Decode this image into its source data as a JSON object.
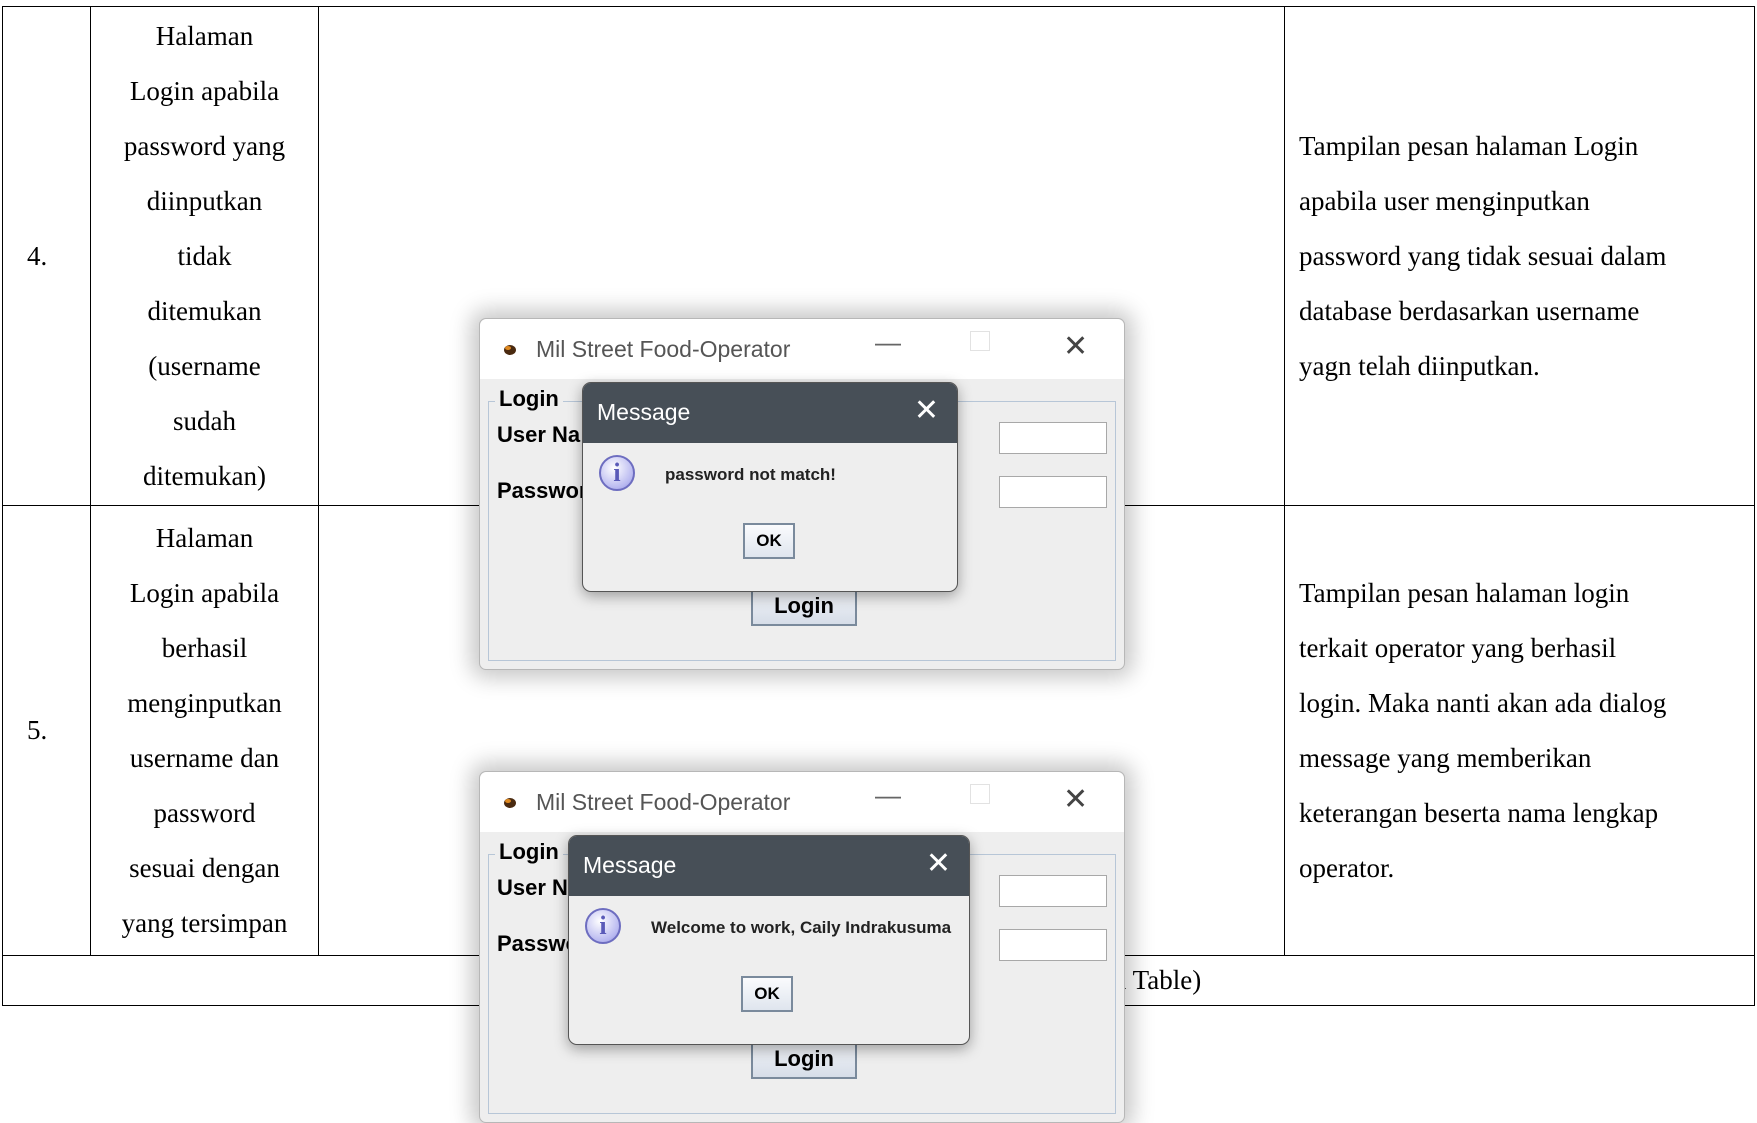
{
  "rows": [
    {
      "number": "4.",
      "step_lines": [
        "Halaman",
        "Login apabila",
        "password yang",
        "diinputkan",
        "tidak",
        "ditemukan",
        "(username",
        "sudah",
        "ditemukan)"
      ],
      "screenshot": {
        "window_title": "Mil Street Food-Operator",
        "group_label": "Login",
        "field_user": "User Na",
        "field_password": "Passwor",
        "login_button": "Login",
        "dialog_title": "Message",
        "dialog_message": "password not match!",
        "ok_button": "OK"
      },
      "description_lines": [
        "Tampilan pesan halaman Login",
        "apabila user menginputkan",
        "password yang tidak sesuai dalam",
        "database berdasarkan username",
        "yagn telah diinputkan."
      ]
    },
    {
      "number": "5.",
      "step_lines": [
        "Halaman",
        "Login apabila",
        "berhasil",
        "menginputkan",
        "username dan",
        "password",
        "sesuai dengan",
        "yang tersimpan"
      ],
      "screenshot": {
        "window_title": "Mil Street Food-Operator",
        "group_label": "Login",
        "field_user": "User N",
        "field_password": "Passwo",
        "login_button": "Login",
        "dialog_title": "Message",
        "dialog_message": "Welcome to work, Caily Indrakusuma",
        "ok_button": "OK"
      },
      "description_lines": [
        "Tampilan pesan halaman login",
        "terkait operator yang berhasil",
        "login. Maka nanti akan ada dialog",
        "message yang memberikan",
        "keterangan beserta nama lengkap",
        "operator."
      ]
    }
  ],
  "footer": "NEW SALES ENTRY  (versi 1 – image ada di dalam Table)",
  "colors": {
    "dialog_bar": "#474f57",
    "window_bg": "#eeeeee",
    "group_border": "#b7c6d7"
  },
  "icons": [
    "app-icon",
    "minimize-icon",
    "maximize-icon",
    "close-icon",
    "info-icon"
  ]
}
